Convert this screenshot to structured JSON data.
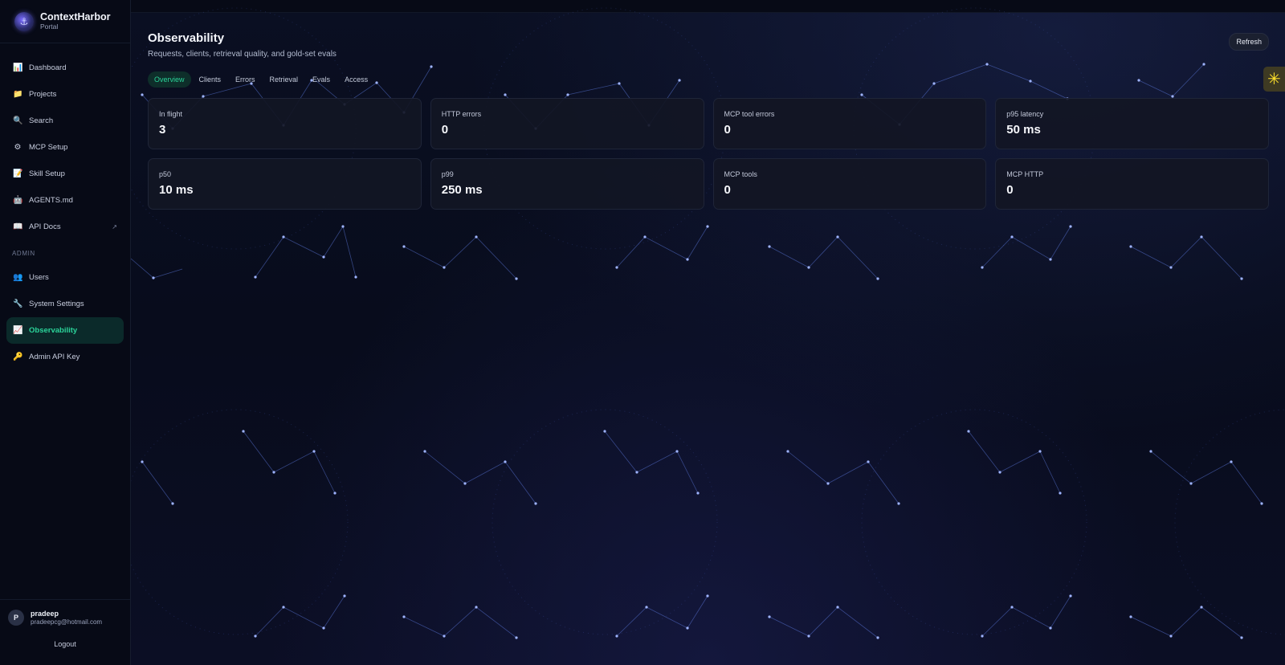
{
  "brand": {
    "name": "ContextHarbor",
    "subtitle": "Portal",
    "logo_icon": "harbor-logo-icon"
  },
  "sidebar": {
    "items": [
      {
        "label": "Dashboard",
        "icon": "bar-chart-icon",
        "glyph": "📊"
      },
      {
        "label": "Projects",
        "icon": "folder-icon",
        "glyph": "📁"
      },
      {
        "label": "Search",
        "icon": "magnifier-icon",
        "glyph": "🔍"
      },
      {
        "label": "MCP Setup",
        "icon": "gear-icon",
        "glyph": "⚙"
      },
      {
        "label": "Skill Setup",
        "icon": "memo-icon",
        "glyph": "📝"
      },
      {
        "label": "AGENTS.md",
        "icon": "robot-icon",
        "glyph": "🤖"
      },
      {
        "label": "API Docs",
        "icon": "book-icon",
        "glyph": "📖",
        "ext": "↗"
      }
    ],
    "admin_label": "ADMIN",
    "admin_items": [
      {
        "label": "Users",
        "icon": "users-icon",
        "glyph": "👥"
      },
      {
        "label": "System Settings",
        "icon": "wrench-icon",
        "glyph": "🔧"
      },
      {
        "label": "Observability",
        "icon": "chart-up-icon",
        "glyph": "📈",
        "active": true
      },
      {
        "label": "Admin API Key",
        "icon": "key-icon",
        "glyph": "🔑"
      }
    ]
  },
  "user": {
    "initial": "P",
    "name": "pradeep",
    "email": "pradeepcg@hotmail.com",
    "logout_label": "Logout"
  },
  "page": {
    "title": "Observability",
    "subtitle": "Requests, clients, retrieval quality, and gold-set evals",
    "refresh_label": "Refresh"
  },
  "tabs": [
    {
      "label": "Overview",
      "active": true
    },
    {
      "label": "Clients"
    },
    {
      "label": "Errors"
    },
    {
      "label": "Retrieval"
    },
    {
      "label": "Evals"
    },
    {
      "label": "Access"
    }
  ],
  "metrics": [
    {
      "label": "In flight",
      "value": "3"
    },
    {
      "label": "HTTP errors",
      "value": "0"
    },
    {
      "label": "MCP tool errors",
      "value": "0"
    },
    {
      "label": "p95 latency",
      "value": "50 ms"
    },
    {
      "label": "p50",
      "value": "10 ms"
    },
    {
      "label": "p99",
      "value": "250 ms"
    },
    {
      "label": "MCP tools",
      "value": "0"
    },
    {
      "label": "MCP HTTP",
      "value": "0"
    }
  ],
  "widget": {
    "icon": "asterisk-icon",
    "glyph": "✳"
  },
  "colors": {
    "accent": "#2bd49a",
    "background": "#070b19",
    "card": "#12162a",
    "widget": "#ffe12b"
  }
}
